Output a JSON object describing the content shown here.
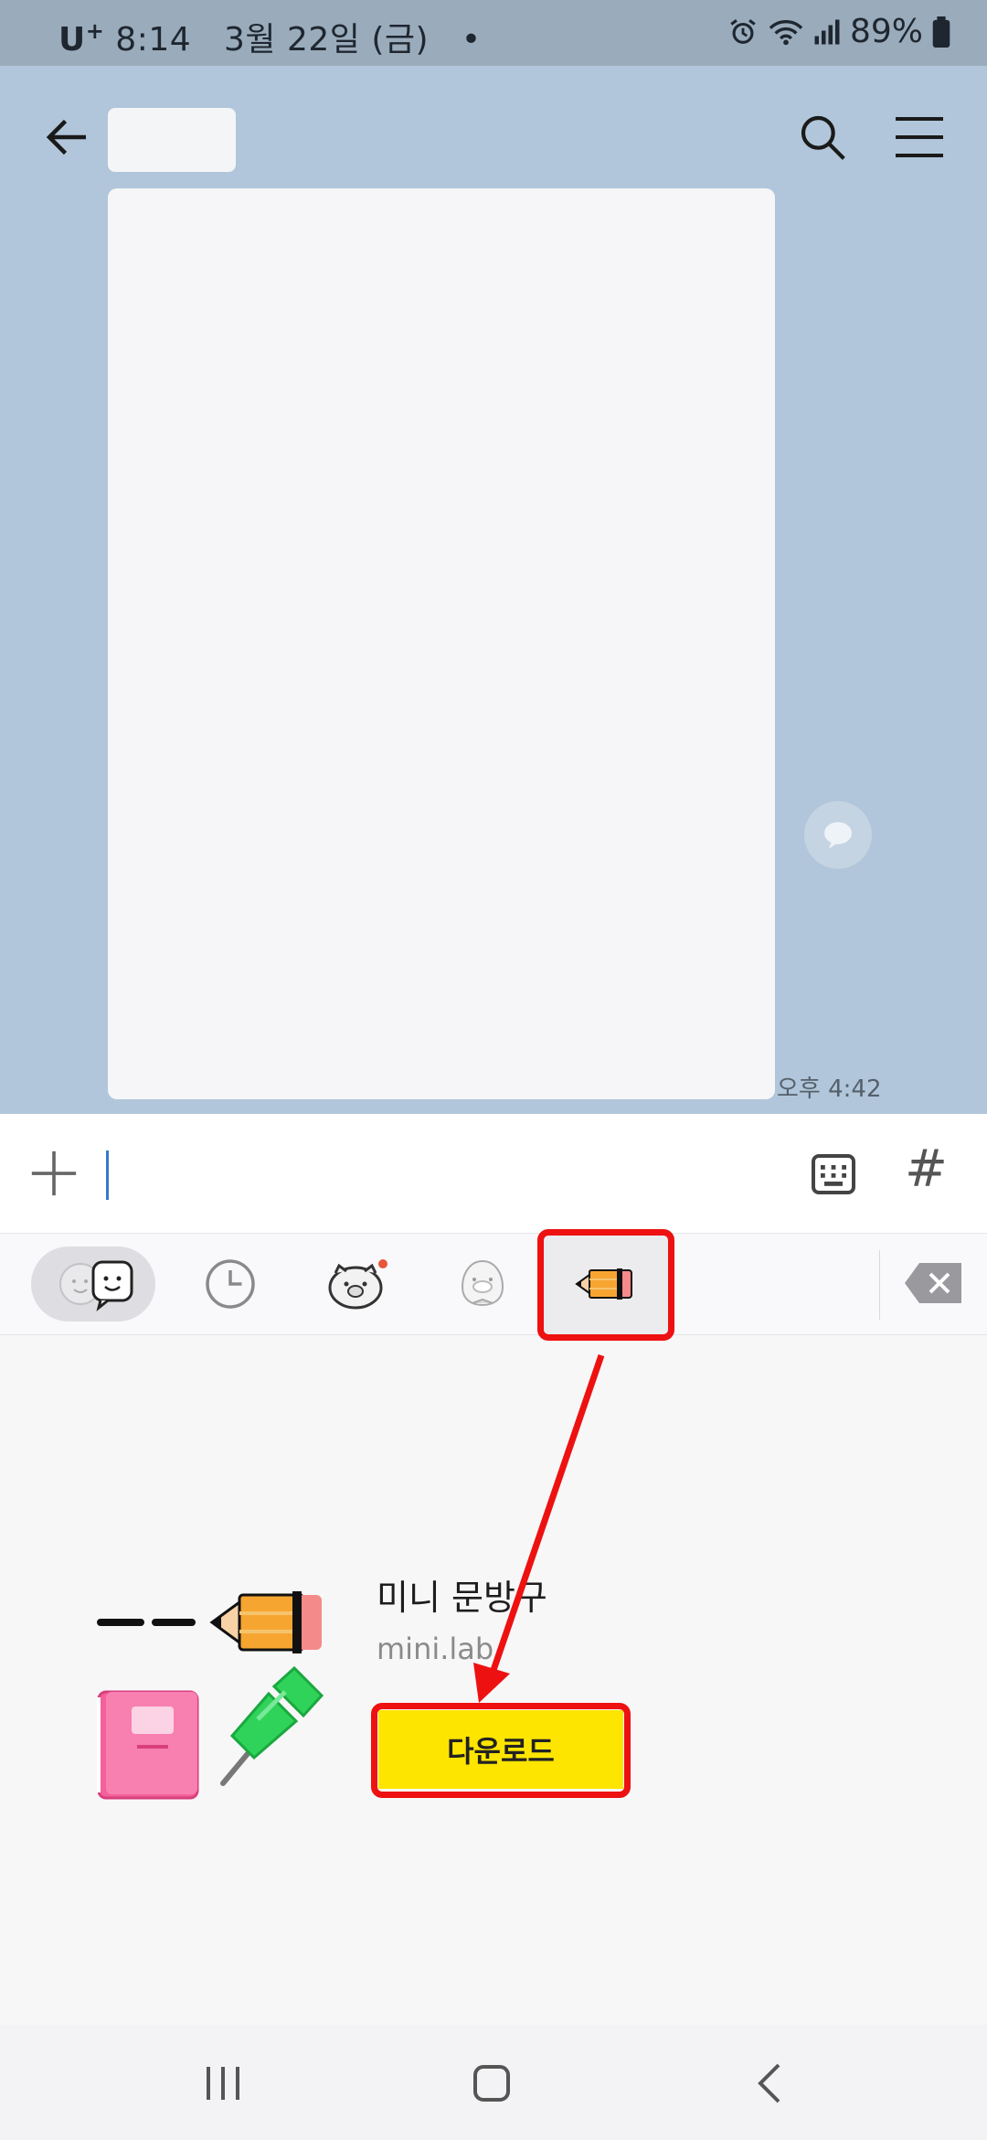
{
  "status_bar": {
    "carrier": "U",
    "carrier_sup": "+",
    "time": "8:14",
    "date": "3월 22일 (금)",
    "dot": "•",
    "battery": "89%"
  },
  "chat": {
    "timestamp": "오후 4:42"
  },
  "input": {
    "hash": "#"
  },
  "emoticon_tabs": {
    "selected": "pencil"
  },
  "sticker_pack": {
    "name": "미니 문방구",
    "author": "mini.lab",
    "download_label": "다운로드"
  },
  "colors": {
    "chat_background": "#b1c6da",
    "download_button": "#fee500",
    "annotation": "#ee1111"
  }
}
